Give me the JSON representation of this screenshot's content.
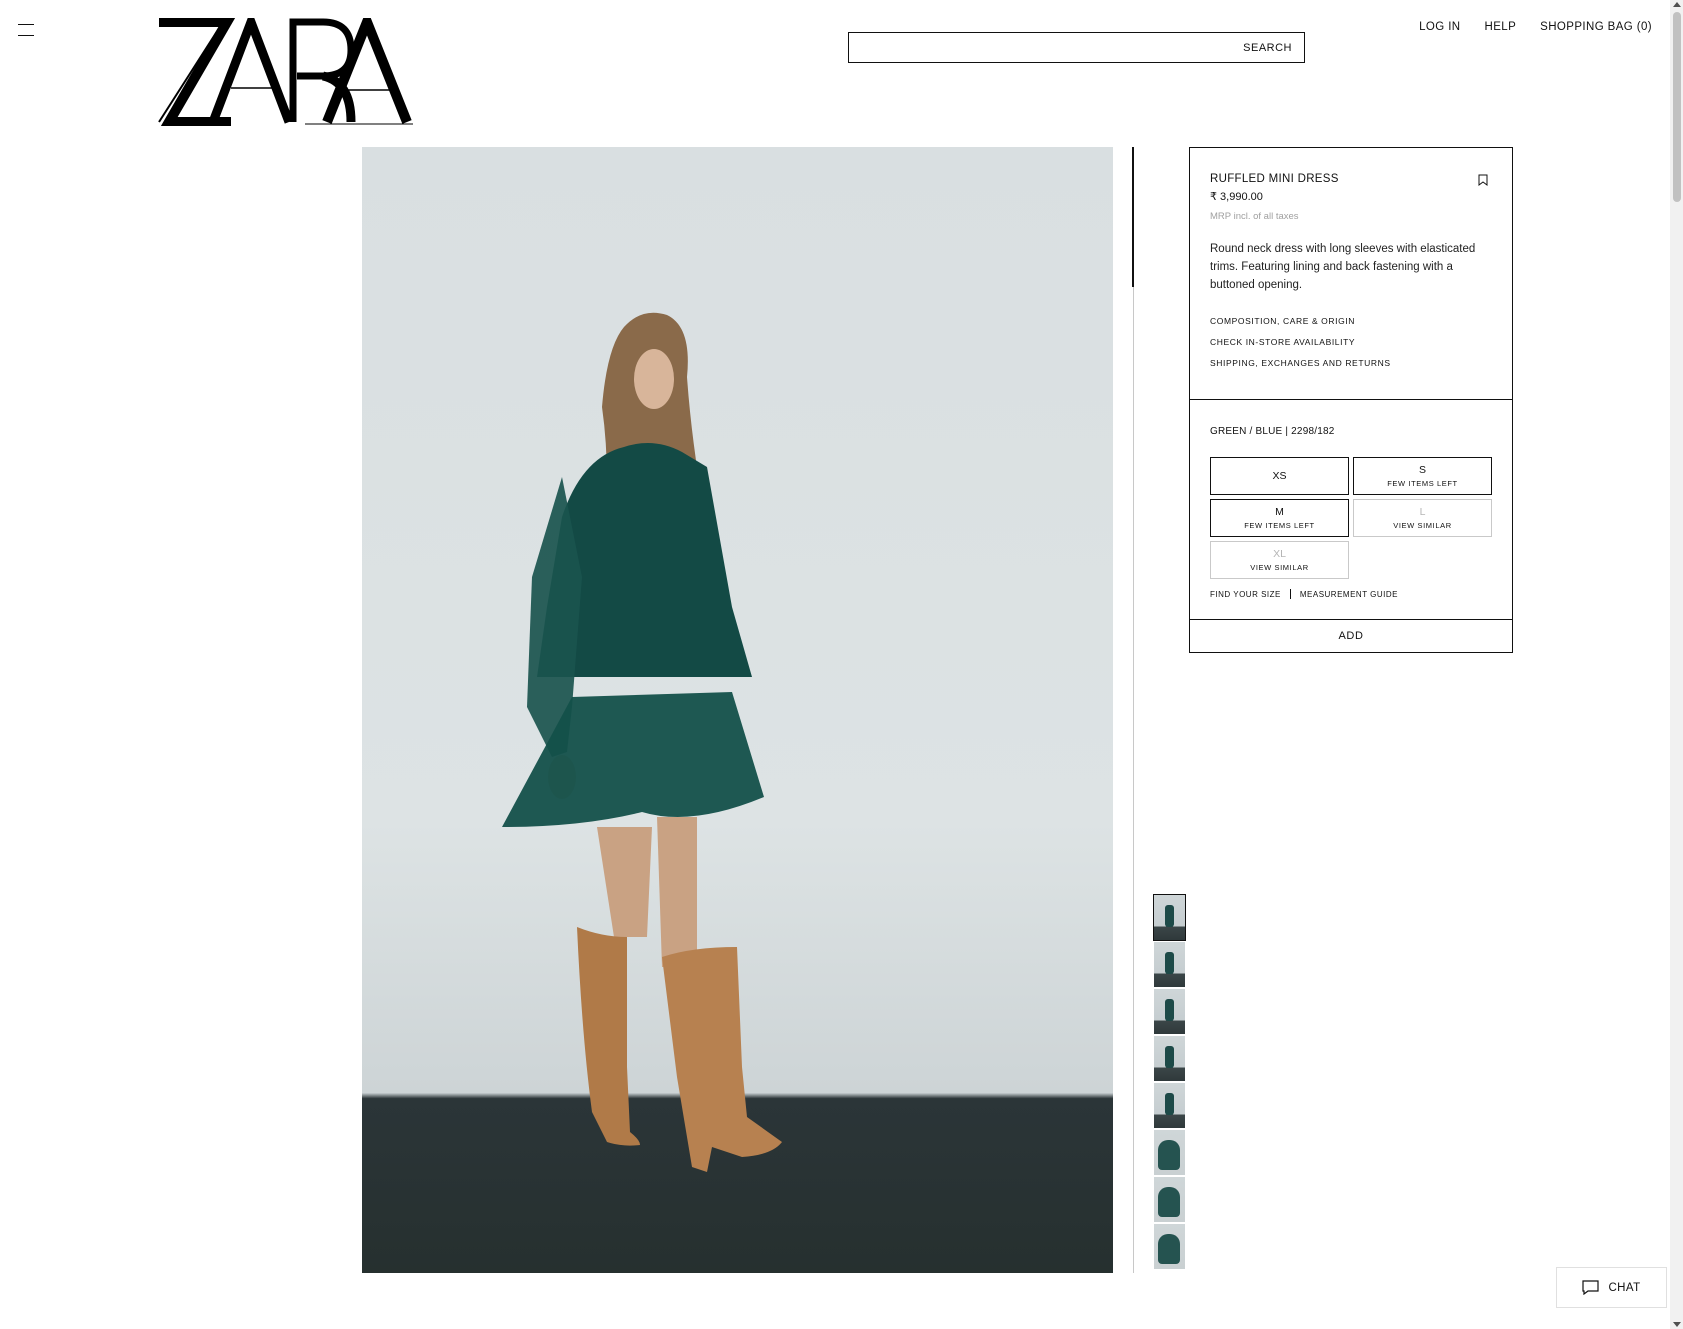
{
  "header": {
    "logo_text": "ZARA",
    "search_label": "SEARCH",
    "nav": {
      "login": "LOG IN",
      "help": "HELP",
      "bag": "SHOPPING BAG (0)"
    }
  },
  "product": {
    "name": "RUFFLED MINI DRESS",
    "price": "₹ 3,990.00",
    "tax_note": "MRP incl. of all taxes",
    "description": "Round neck dress with long sleeves with elasticated trims. Featuring lining and back fastening with a buttoned opening.",
    "links": [
      "COMPOSITION, CARE & ORIGIN",
      "CHECK IN-STORE AVAILABILITY",
      "SHIPPING, EXCHANGES AND RETURNS"
    ],
    "color_ref": "GREEN / BLUE | 2298/182",
    "sizes": [
      {
        "label": "XS",
        "note": "",
        "available": true
      },
      {
        "label": "S",
        "note": "FEW ITEMS LEFT",
        "available": true
      },
      {
        "label": "M",
        "note": "FEW ITEMS LEFT",
        "available": true
      },
      {
        "label": "L",
        "note": "VIEW SIMILAR",
        "available": false
      },
      {
        "label": "XL",
        "note": "VIEW SIMILAR",
        "available": false
      }
    ],
    "find_size": "FIND YOUR SIZE",
    "measurement_guide": "MEASUREMENT GUIDE",
    "add_label": "ADD",
    "thumbnail_count": 8
  },
  "chat": {
    "label": "CHAT"
  },
  "colors": {
    "dress": "#134a45",
    "boots": "#b07a48",
    "wall": "#dde3e4",
    "floor": "#27302f"
  },
  "icons": {
    "menu": "hamburger-icon",
    "bookmark": "bookmark-icon",
    "chat": "chat-bubble-icon"
  }
}
